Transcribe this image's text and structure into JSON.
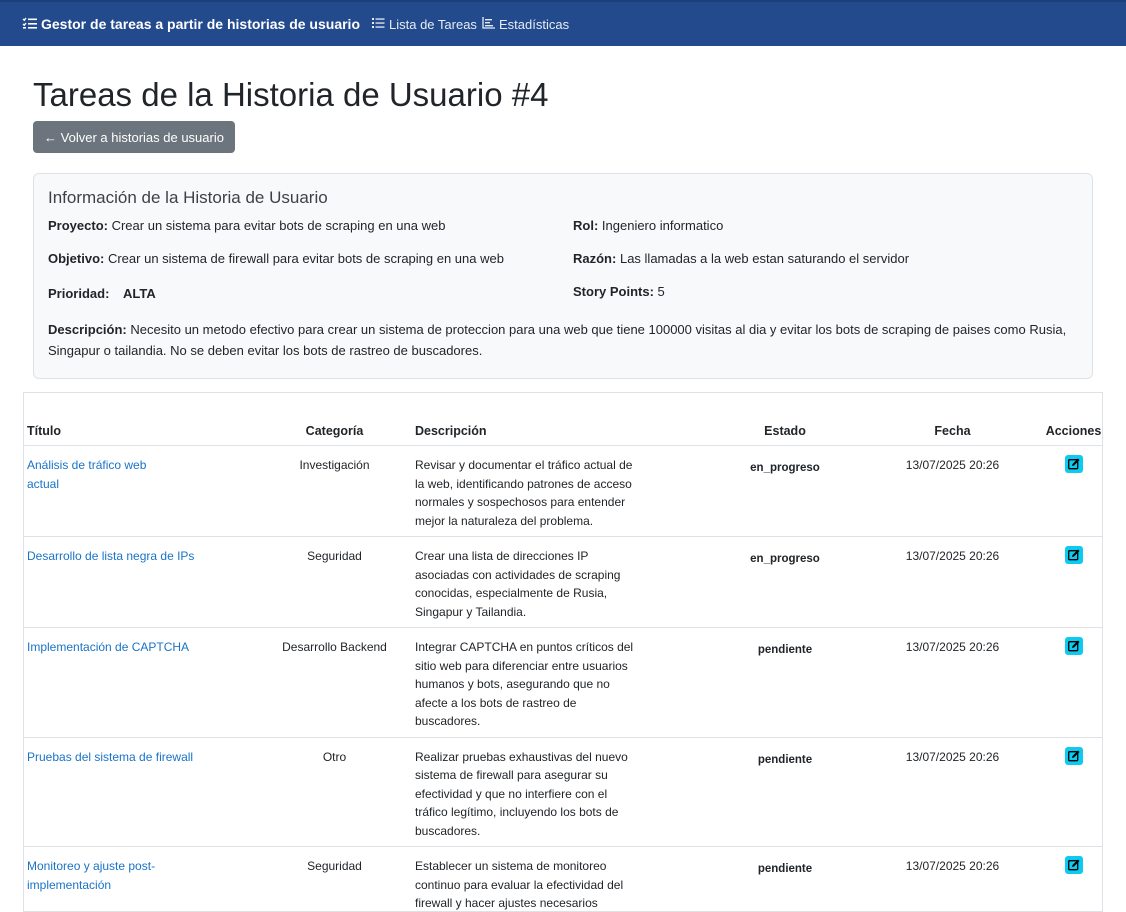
{
  "navbar": {
    "brand": "Gestor de tareas a partir de historias de usuario",
    "links": [
      {
        "label": "Lista de Tareas",
        "icon": "list-icon"
      },
      {
        "label": "Estadísticas",
        "icon": "chart-icon"
      }
    ]
  },
  "page": {
    "title": "Tareas de la Historia de Usuario #4",
    "back_label": "← Volver a historias de usuario"
  },
  "info": {
    "heading": "Información de la Historia de Usuario",
    "proyecto_label": "Proyecto:",
    "proyecto": "Crear un sistema para evitar bots de scraping en una web",
    "rol_label": "Rol:",
    "rol": "Ingeniero informatico",
    "objetivo_label": "Objetivo:",
    "objetivo": "Crear un sistema de firewall para evitar bots de scraping en una web",
    "razon_label": "Razón:",
    "razon": "Las llamadas a la web estan saturando el servidor",
    "prioridad_label": "Prioridad:",
    "prioridad": "ALTA",
    "story_points_label": "Story Points:",
    "story_points": "5",
    "descripcion_label": "Descripción:",
    "descripcion": "Necesito un metodo efectivo para crear un sistema de proteccion para una web que tiene 100000 visitas al dia y evitar los bots de scraping de paises como Rusia, Singapur o tailandia. No se deben evitar los bots de rastreo de buscadores."
  },
  "table": {
    "headers": [
      "Título",
      "Categoría",
      "Descripción",
      "Estado",
      "Fecha",
      "Acciones"
    ],
    "rows": [
      {
        "titulo": "Análisis de tráfico web actual",
        "categoria": "Investigación",
        "descripcion": "Revisar y documentar el tráfico actual de la web, identificando patrones de acceso normales y sospechosos para entender mejor la naturaleza del problema.",
        "estado": "en_progreso",
        "fecha": "13/07/2025 20:26"
      },
      {
        "titulo": "Desarrollo de lista negra de IPs",
        "categoria": "Seguridad",
        "descripcion": "Crear una lista de direcciones IP asociadas con actividades de scraping conocidas, especialmente de Rusia, Singapur y Tailandia.",
        "estado": "en_progreso",
        "fecha": "13/07/2025 20:26"
      },
      {
        "titulo": "Implementación de CAPTCHA",
        "categoria": "Desarrollo Backend",
        "descripcion": "Integrar CAPTCHA en puntos críticos del sitio web para diferenciar entre usuarios humanos y bots, asegurando que no afecte a los bots de rastreo de buscadores.",
        "estado": "pendiente",
        "fecha": "13/07/2025 20:26"
      },
      {
        "titulo": "Pruebas del sistema de firewall",
        "categoria": "Otro",
        "descripcion": "Realizar pruebas exhaustivas del nuevo sistema de firewall para asegurar su efectividad y que no interfiere con el tráfico legítimo, incluyendo los bots de buscadores.",
        "estado": "pendiente",
        "fecha": "13/07/2025 20:26"
      },
      {
        "titulo": "Monitoreo y ajuste post-implementación",
        "categoria": "Seguridad",
        "descripcion": "Establecer un sistema de monitoreo continuo para evaluar la efectividad del firewall y hacer ajustes necesarios basados en los resultados observados y",
        "estado": "pendiente",
        "fecha": "13/07/2025 20:26"
      }
    ]
  },
  "colors": {
    "navbar": "#224a8c",
    "link": "#1a73c7",
    "edit_button": "#0dcaf0",
    "back_button": "#6c757d"
  }
}
